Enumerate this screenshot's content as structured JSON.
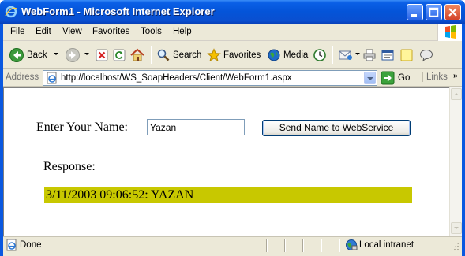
{
  "window": {
    "title": "WebForm1 - Microsoft Internet Explorer"
  },
  "menubar": {
    "items": [
      "File",
      "Edit",
      "View",
      "Favorites",
      "Tools",
      "Help"
    ]
  },
  "toolbar": {
    "back": "Back",
    "search": "Search",
    "favorites": "Favorites",
    "media": "Media"
  },
  "addressbar": {
    "label": "Address",
    "url": "http://localhost/WS_SoapHeaders/Client/WebForm1.aspx",
    "go": "Go",
    "links": "Links"
  },
  "page": {
    "enter_label": "Enter Your Name:",
    "name_value": "Yazan",
    "send_button": "Send Name to WebService",
    "response_label": "Response:",
    "response_text": "3/11/2003 09:06:52: YAZAN",
    "response_bg": "#c8c800"
  },
  "statusbar": {
    "status": "Done",
    "zone": "Local intranet"
  },
  "colors": {
    "titlebar": "#0454d8",
    "chrome": "#ece9d8"
  }
}
